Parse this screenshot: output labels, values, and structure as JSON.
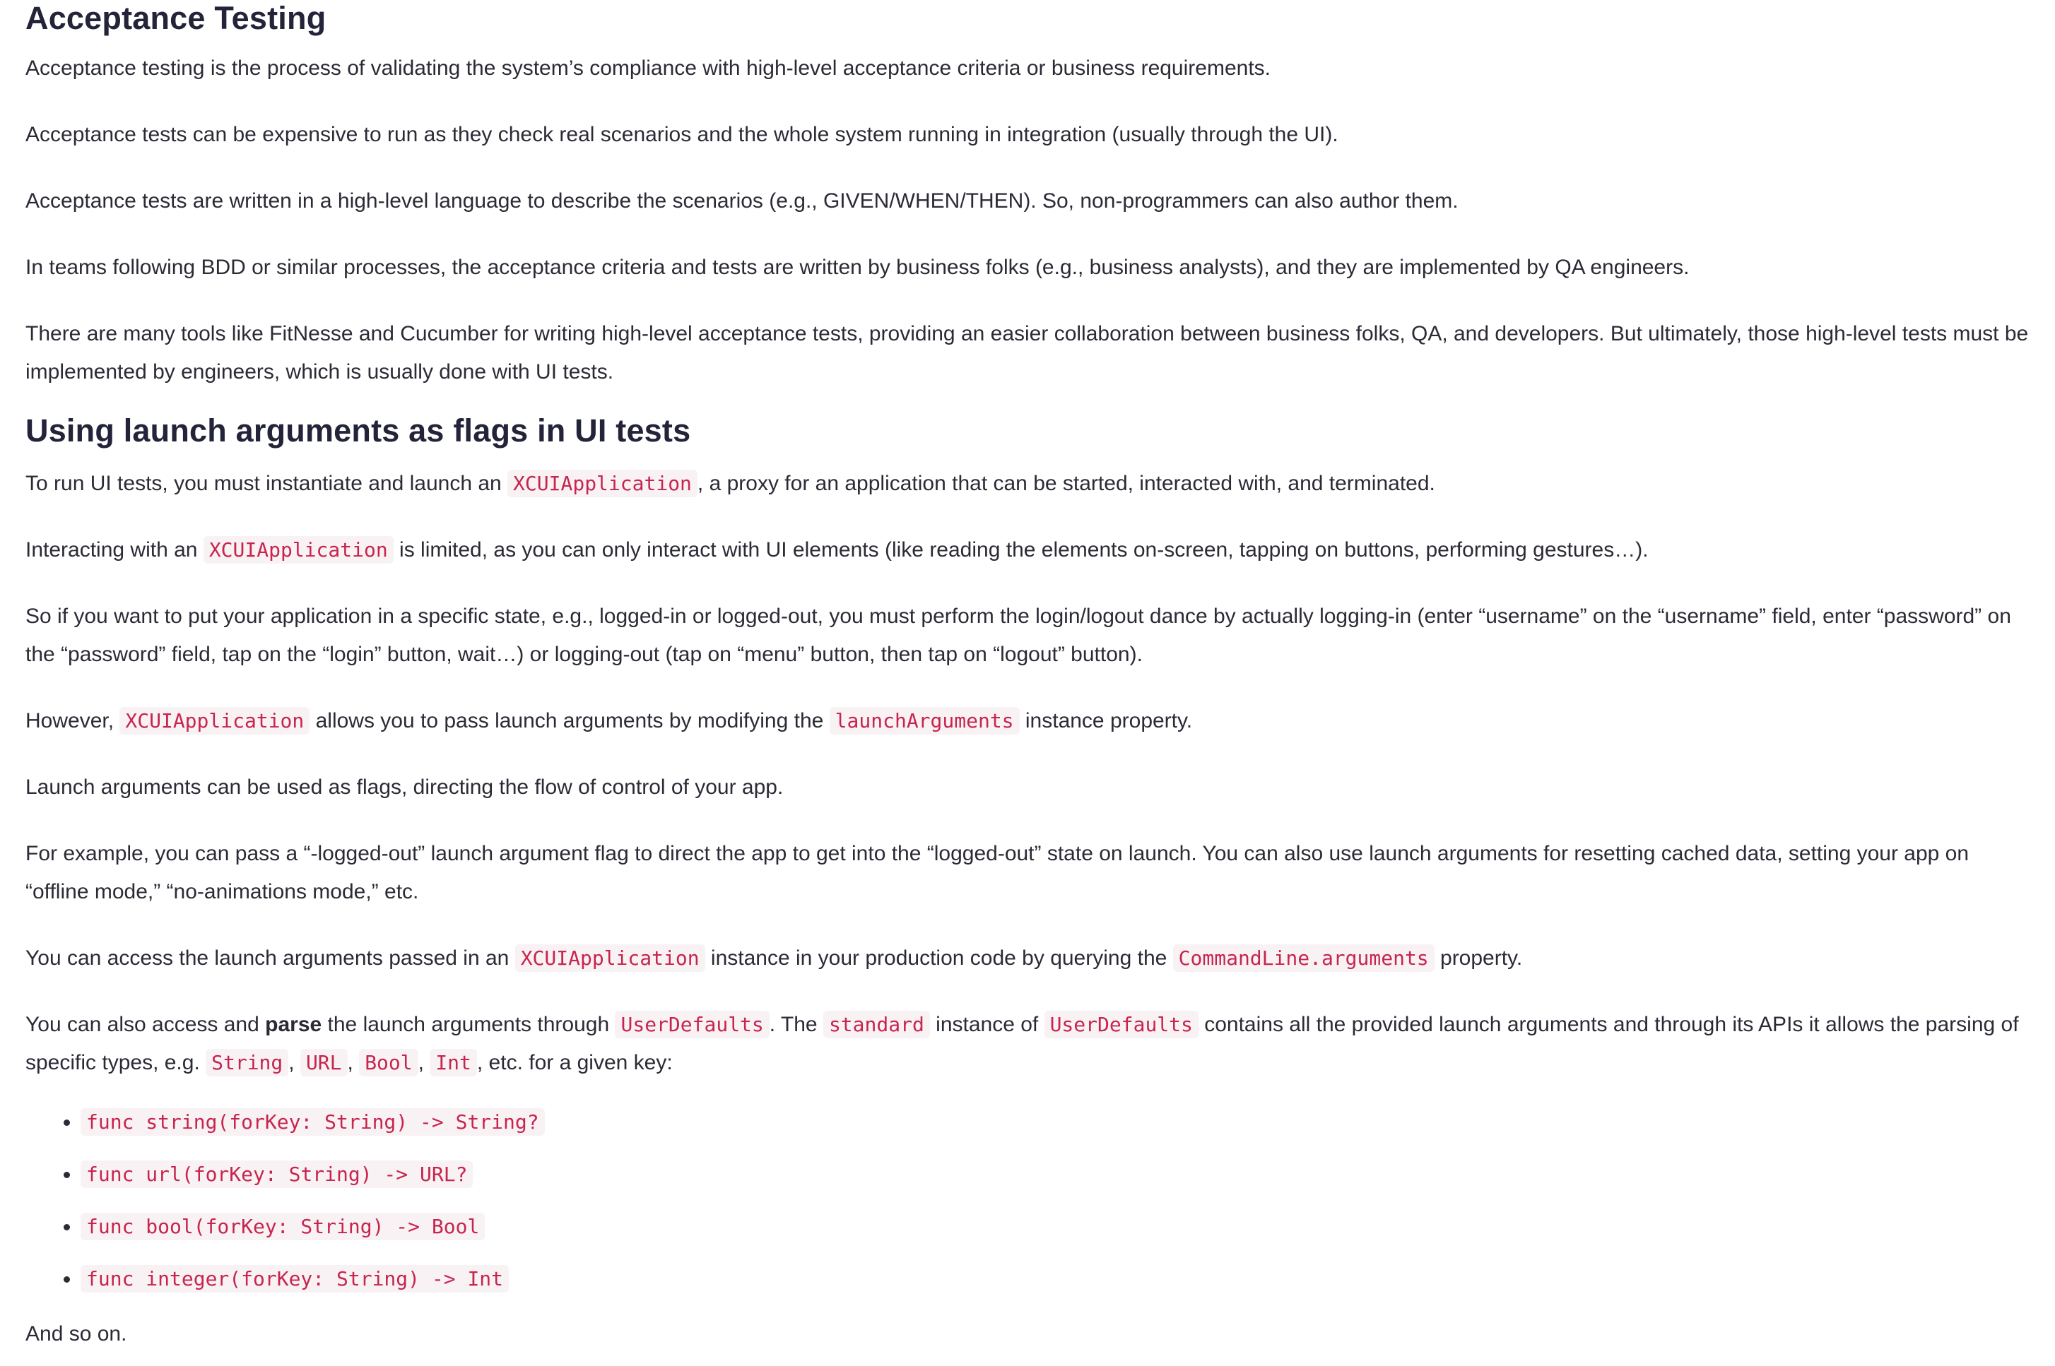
{
  "section1": {
    "heading": "Acceptance Testing",
    "p1": "Acceptance testing is the process of validating the system’s compliance with high-level acceptance criteria or business requirements.",
    "p2": "Acceptance tests can be expensive to run as they check real scenarios and the whole system running in integration (usually through the UI).",
    "p3": "Acceptance tests are written in a high-level language to describe the scenarios (e.g., GIVEN/WHEN/THEN). So, non-programmers can also author them.",
    "p4": "In teams following BDD or similar processes, the acceptance criteria and tests are written by business folks (e.g., business analysts), and they are implemented by QA engineers.",
    "p5": "There are many tools like FitNesse and Cucumber for writing high-level acceptance tests, providing an easier collaboration between business folks, QA, and developers. But ultimately, those high-level tests must be implemented by engineers, which is usually done with UI tests."
  },
  "section2": {
    "heading": "Using launch arguments as flags in UI tests",
    "p1": {
      "a": "To run UI tests, you must instantiate and launch an ",
      "code": "XCUIApplication",
      "b": ", a proxy for an application that can be started, interacted with, and terminated."
    },
    "p2": {
      "a": "Interacting with an ",
      "code": "XCUIApplication",
      "b": " is limited, as you can only interact with UI elements (like reading the elements on-screen, tapping on buttons, performing gestures…)."
    },
    "p3": "So if you want to put your application in a specific state, e.g., logged-in or logged-out, you must perform the login/logout dance by actually logging-in (enter “username” on the “username” field, enter “password” on the “password” field, tap on the “login” button, wait…) or logging-out (tap on “menu” button, then tap on “logout” button).",
    "p4": {
      "a": "However, ",
      "code1": "XCUIApplication",
      "b": " allows you to pass launch arguments by modifying the ",
      "code2": "launchArguments",
      "c": " instance property."
    },
    "p5": "Launch arguments can be used as flags, directing the flow of control of your app.",
    "p6": "For example, you can pass a “-logged-out” launch argument flag to direct the app to get into the “logged-out” state on launch. You can also use launch arguments for resetting cached data, setting your app on “offline mode,” “no-animations mode,” etc.",
    "p7": {
      "a": "You can access the launch arguments passed in an ",
      "code1": "XCUIApplication",
      "b": " instance in your production code by querying the ",
      "code2": "CommandLine.arguments",
      "c": " property."
    },
    "p8": {
      "a": "You can also access and ",
      "strong": "parse",
      "b": " the launch arguments through ",
      "code1": "UserDefaults",
      "c": ". The ",
      "code2": "standard",
      "d": " instance of ",
      "code3": "UserDefaults",
      "e": " contains all the provided launch arguments and through its APIs it allows the parsing of specific types, e.g. ",
      "code4": "String",
      "sep1": ", ",
      "code5": "URL",
      "sep2": ", ",
      "code6": "Bool",
      "sep3": ", ",
      "code7": "Int",
      "f": ", etc. for a given key:"
    },
    "list": [
      "func string(forKey: String) -> String?",
      "func url(forKey: String) -> URL?",
      "func bool(forKey: String) -> Bool",
      "func integer(forKey: String) -> Int"
    ],
    "closing": "And so on."
  }
}
